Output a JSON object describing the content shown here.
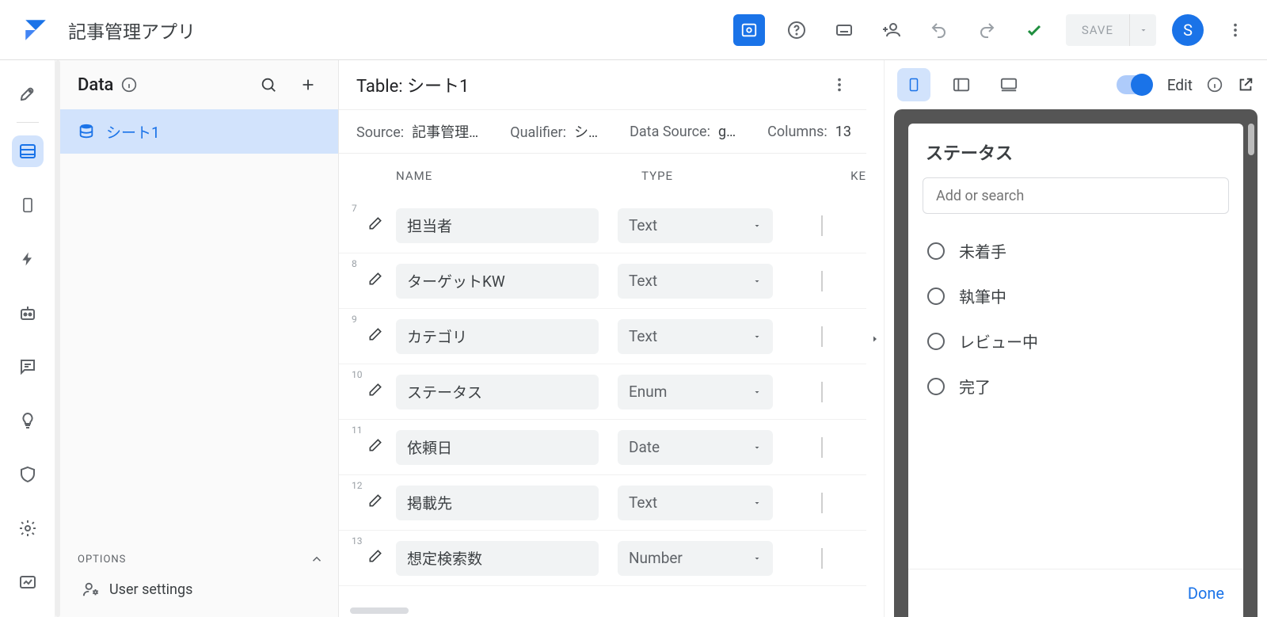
{
  "app": {
    "title": "記事管理アプリ",
    "avatar_initial": "S",
    "save_label": "SAVE"
  },
  "side": {
    "title": "Data",
    "items": [
      {
        "label": "シート1"
      }
    ],
    "options_label": "OPTIONS",
    "user_settings_label": "User settings"
  },
  "table": {
    "header_prefix": "Table: ",
    "header_name": "シート1",
    "meta": {
      "source_label": "Source:",
      "source_value": "記事管理…",
      "qualifier_label": "Qualifier:",
      "qualifier_value": "シ…",
      "datasource_label": "Data Source:",
      "datasource_value": "g…",
      "columns_label": "Columns:",
      "columns_value": "13"
    },
    "head": {
      "name": "NAME",
      "type": "TYPE",
      "key": "KE"
    },
    "rows": [
      {
        "num": "7",
        "name": "担当者",
        "type": "Text"
      },
      {
        "num": "8",
        "name": "ターゲットKW",
        "type": "Text"
      },
      {
        "num": "9",
        "name": "カテゴリ",
        "type": "Text"
      },
      {
        "num": "10",
        "name": "ステータス",
        "type": "Enum"
      },
      {
        "num": "11",
        "name": "依頼日",
        "type": "Date"
      },
      {
        "num": "12",
        "name": "掲載先",
        "type": "Text"
      },
      {
        "num": "13",
        "name": "想定検索数",
        "type": "Number"
      }
    ]
  },
  "preview": {
    "edit_label": "Edit",
    "status_title": "ステータス",
    "search_placeholder": "Add or search",
    "options": [
      "未着手",
      "執筆中",
      "レビュー中",
      "完了"
    ],
    "done_label": "Done"
  }
}
